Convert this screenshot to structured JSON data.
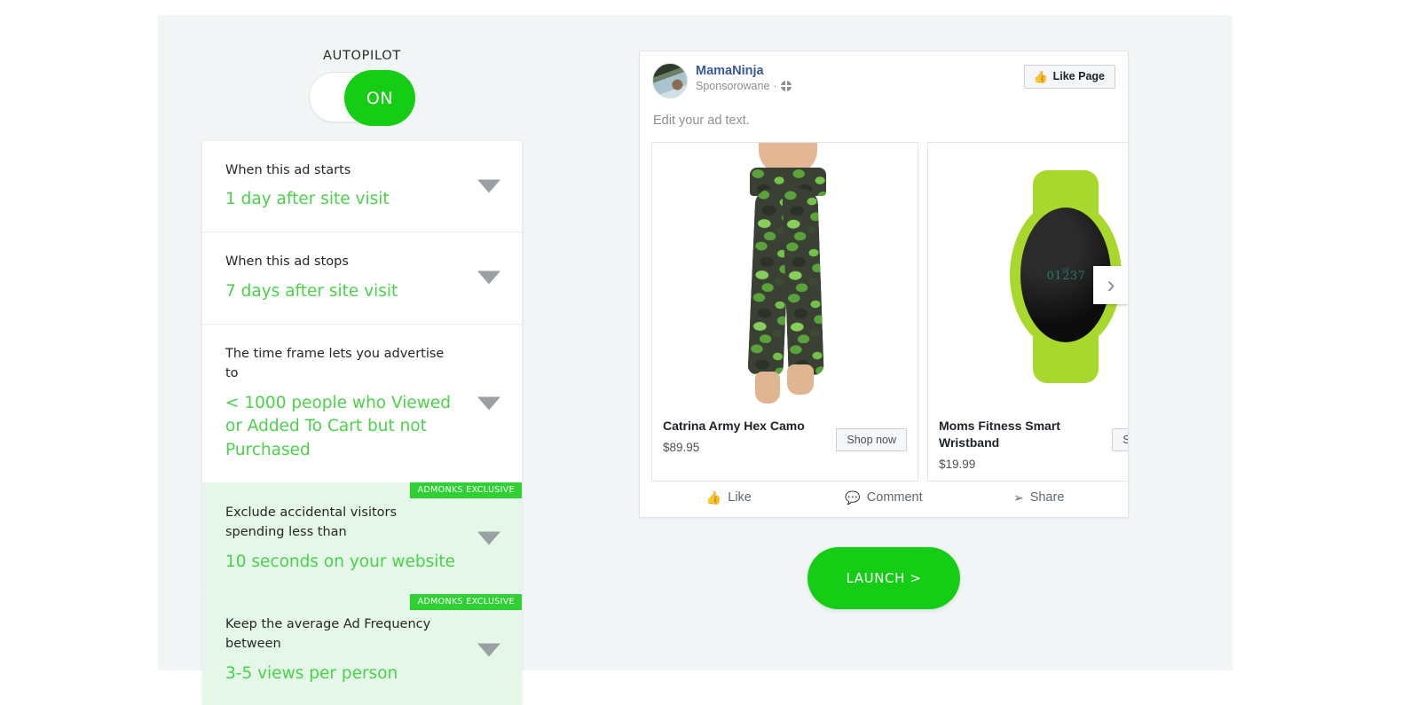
{
  "autopilot": {
    "label": "AUTOPILOT",
    "state": "ON",
    "accent_color": "#16cd16"
  },
  "options": [
    {
      "question": "When this ad starts",
      "value": "1 day after site visit",
      "exclusive": false,
      "badge": "",
      "caret": "chevron-down-icon"
    },
    {
      "question": "When this ad stops",
      "value": "7 days after site visit",
      "exclusive": false,
      "badge": "",
      "caret": "chevron-down-icon"
    },
    {
      "question": "The time frame lets you advertise to",
      "value": "< 1000 people who Viewed or Added To Cart but not Purchased",
      "exclusive": false,
      "badge": "",
      "caret": "chevron-down-icon"
    },
    {
      "question": "Exclude accidental visitors spending less than",
      "value": "10 seconds on your website",
      "exclusive": true,
      "badge": "ADMONKS EXCLUSIVE",
      "caret": "chevron-down-icon"
    },
    {
      "question": "Keep the average Ad Frequency between",
      "value": "3-5 views per person",
      "exclusive": true,
      "badge": "ADMONKS EXCLUSIVE",
      "caret": "chevron-down-icon"
    }
  ],
  "ad_preview": {
    "page_name": "MamaNinja",
    "sponsored_label": "Sponsorowane",
    "separator": "·",
    "globe_icon": "globe-icon",
    "like_page_button": "Like Page",
    "like_page_icon": "thumbs-up-icon",
    "ad_text": "Edit your ad text.",
    "next_arrow": "chevron-right-icon",
    "products": [
      {
        "title": "Catrina Army Hex Camo",
        "price": "$89.95",
        "cta": "Shop now",
        "image": "camo-leggings-photo"
      },
      {
        "title": "Moms Fitness Smart Wristband",
        "price": "$19.99",
        "cta": "Shop now",
        "image": "green-smart-wristband-photo",
        "watch_display": "01237",
        "watch_unit": "cal"
      }
    ],
    "actions": [
      {
        "label": "Like",
        "icon": "thumbs-up-outline-icon"
      },
      {
        "label": "Comment",
        "icon": "speech-bubble-icon"
      },
      {
        "label": "Share",
        "icon": "share-arrow-icon"
      }
    ]
  },
  "launch": {
    "label": "LAUNCH >"
  },
  "colors": {
    "page_background": "#f2f5f6",
    "green_accent": "#16cd16",
    "value_green": "#4ad24a",
    "badge_green": "#2fd033",
    "exclusive_row_background": "#e4f7e8",
    "fb_link_blue": "#385898"
  }
}
